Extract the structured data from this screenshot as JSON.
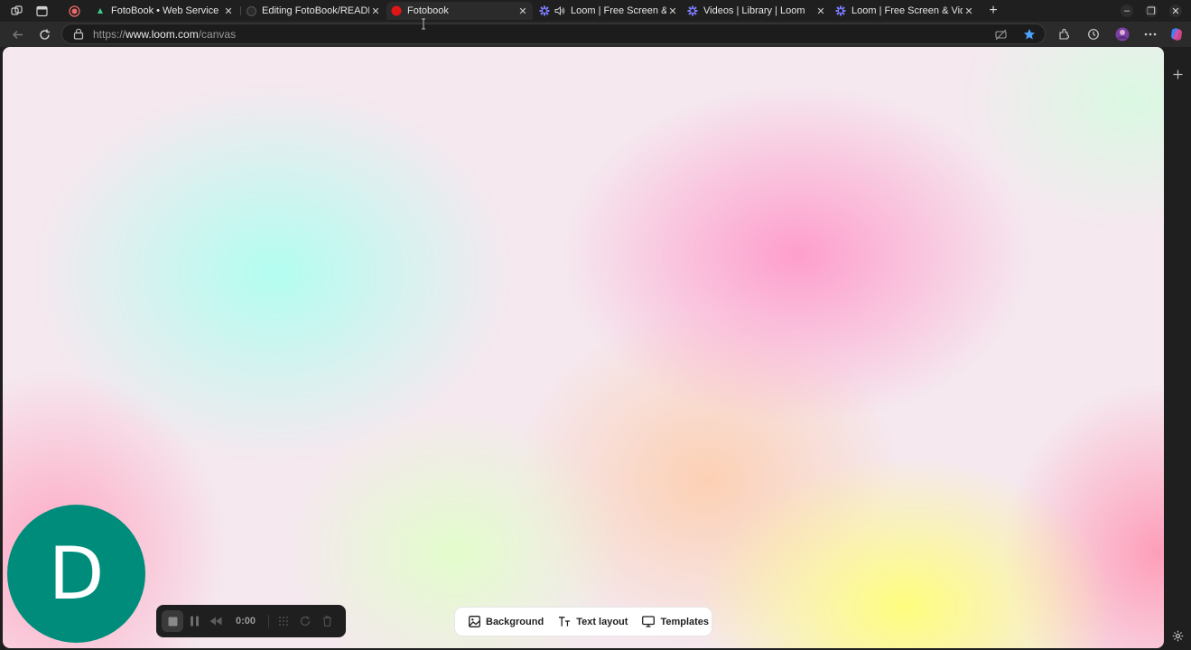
{
  "browser": {
    "tabs": [
      {
        "title": "FotoBook • Web Service",
        "favicon": "green-app-icon"
      },
      {
        "title": "Editing FotoBook/README",
        "favicon": "github-icon"
      },
      {
        "title": "Fotobook",
        "favicon": "red-record-icon",
        "active": true
      },
      {
        "title": "Loom | Free Screen & Video",
        "favicon": "loom-icon",
        "audio": true
      },
      {
        "title": "Videos | Library | Loom",
        "favicon": "loom-icon"
      },
      {
        "title": "Loom | Free Screen & Video",
        "favicon": "loom-icon"
      }
    ],
    "address": {
      "scheme": "https://",
      "host": "www.loom.com",
      "path": "/canvas"
    }
  },
  "canvas": {
    "avatar_initial": "D",
    "avatar_color": "#008c7a",
    "recorder": {
      "time": "0:00"
    },
    "tools": {
      "background_label": "Background",
      "text_layout_label": "Text layout",
      "templates_label": "Templates"
    }
  }
}
